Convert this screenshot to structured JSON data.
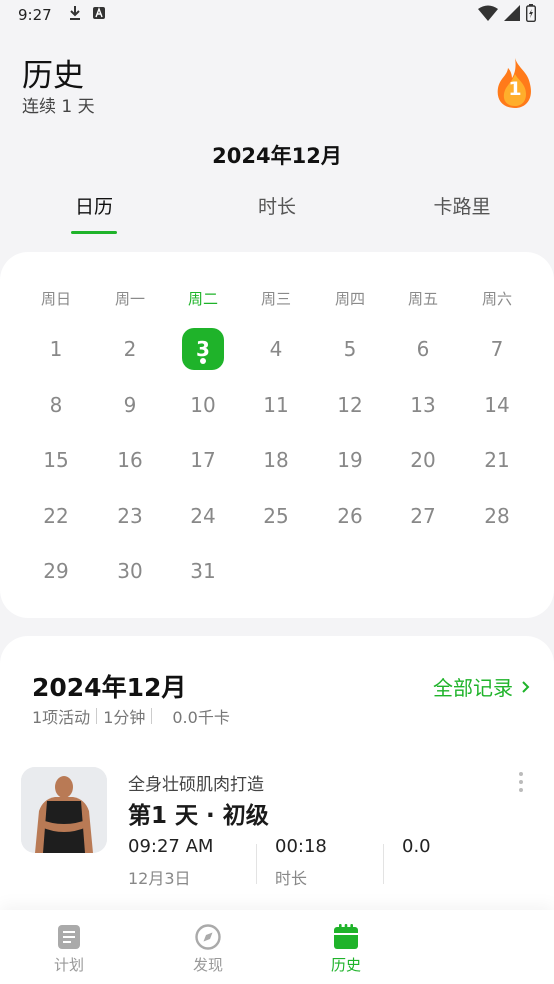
{
  "status_bar": {
    "time": "9:27"
  },
  "header": {
    "title": "历史",
    "subtitle": "连续 1 天",
    "streak_count": "1"
  },
  "month_title": "2024年12月",
  "tabs": [
    {
      "label": "日历",
      "active": true
    },
    {
      "label": "时长",
      "active": false
    },
    {
      "label": "卡路里",
      "active": false
    }
  ],
  "calendar": {
    "weekdays": [
      "周日",
      "周一",
      "周二",
      "周三",
      "周四",
      "周五",
      "周六"
    ],
    "today_weekday_index": 2,
    "days": [
      "1",
      "2",
      "3",
      "4",
      "5",
      "6",
      "7",
      "8",
      "9",
      "10",
      "11",
      "12",
      "13",
      "14",
      "15",
      "16",
      "17",
      "18",
      "19",
      "20",
      "21",
      "22",
      "23",
      "24",
      "25",
      "26",
      "27",
      "28",
      "29",
      "30",
      "31"
    ],
    "selected_day": "3",
    "first_day_column": 0
  },
  "records": {
    "month": "2024年12月",
    "view_all": "全部记录",
    "stats": {
      "activities": "1项活动",
      "duration": "1分钟",
      "calories": "0.0千卡"
    },
    "workouts": [
      {
        "program": "全身壮硕肌肉打造",
        "title": "第1 天 · 初级",
        "time": "09:27 AM",
        "date": "12月3日",
        "duration_value": "00:18",
        "duration_label": "时长",
        "calories_value": "0.0"
      }
    ]
  },
  "bottom_nav": [
    {
      "label": "计划",
      "icon": "plan-icon",
      "active": false
    },
    {
      "label": "发现",
      "icon": "compass-icon",
      "active": false
    },
    {
      "label": "历史",
      "icon": "calendar-icon",
      "active": true
    }
  ],
  "colors": {
    "accent": "#1fb32a",
    "background": "#f4f4f6",
    "card": "#ffffff"
  }
}
